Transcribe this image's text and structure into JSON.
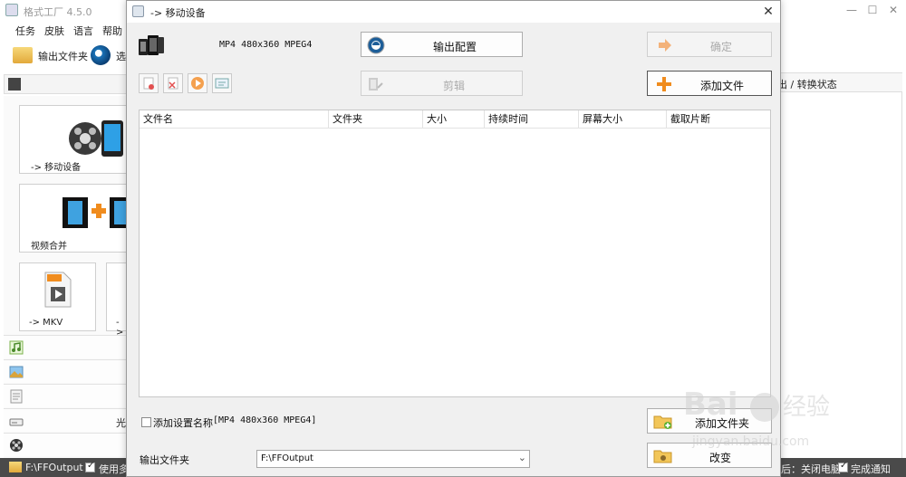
{
  "app": {
    "title": "格式工厂 4.5.0",
    "menu": [
      "任务",
      "皮肤",
      "语言",
      "帮助"
    ],
    "toolbar": {
      "output_folder_label": "输出文件夹",
      "options_label": "选"
    },
    "tiles": {
      "mobile": "-> 移动设备",
      "merge": "视频合并",
      "mkv": "-> MKV",
      "partial": "->"
    },
    "partial_category_label": "光",
    "right_header": "出 / 转换状态",
    "statusbar": {
      "output_path": "F:\\FFOutput",
      "use_label": "使用多",
      "after_label": "后：关闭电脑",
      "notify_label": "完成通知"
    }
  },
  "dialog": {
    "title": "-> 移动设备",
    "preset_text": "MP4 480x360 MPEG4",
    "buttons": {
      "output_config": "输出配置",
      "ok": "确定",
      "edit": "剪辑",
      "add_file": "添加文件",
      "add_folder": "添加文件夹",
      "change": "改变"
    },
    "table_columns": [
      "文件名",
      "文件夹",
      "大小",
      "持续时间",
      "屏幕大小",
      "截取片断"
    ],
    "table_rows": [],
    "option_label": "添加设置名称",
    "option_value": "[MP4 480x360 MPEG4]",
    "output_folder_label": "输出文件夹",
    "output_folder_value": "F:\\FFOutput"
  },
  "watermark": {
    "text": "jingyan.baidu.com"
  },
  "colors": {
    "statusbar_bg": "#4a4a4a",
    "add_icon_orange": "#f08c1e",
    "ok_arrow_orange": "#f3b27a"
  }
}
